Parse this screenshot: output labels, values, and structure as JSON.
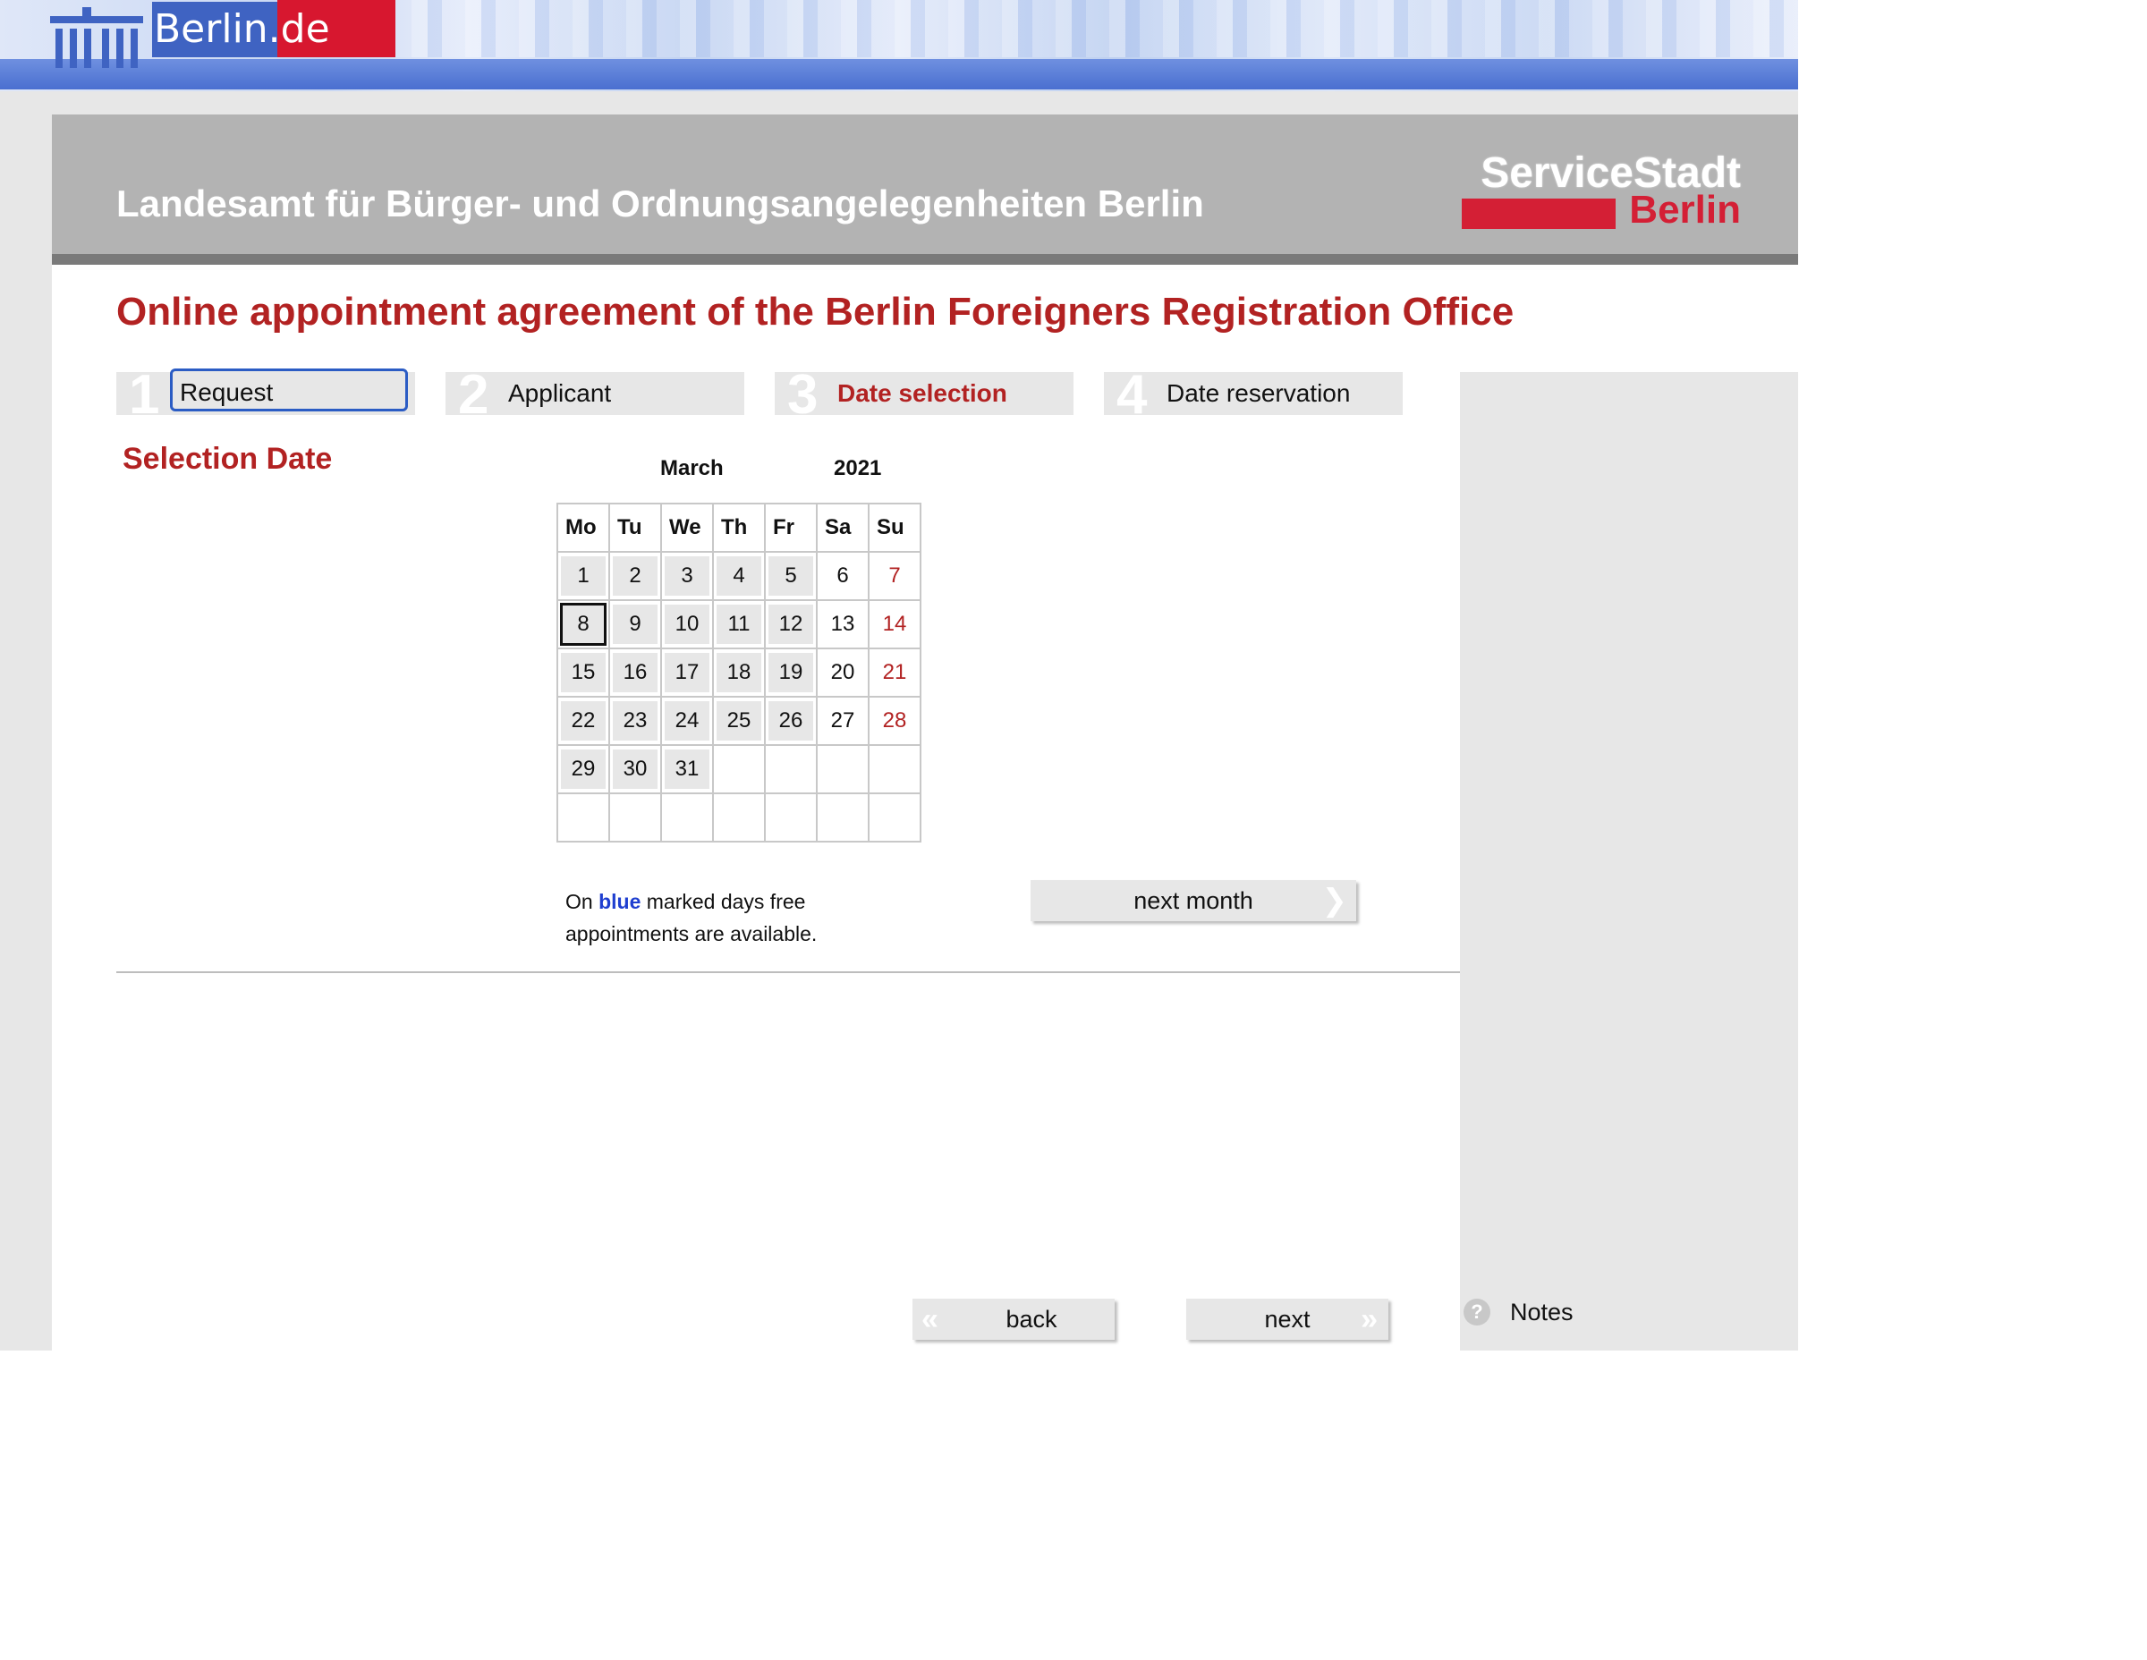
{
  "site": {
    "brand": "Berlin.de"
  },
  "header": {
    "office_title": "Landesamt für Bürger- und Ordnungsangelegenheiten Berlin",
    "logo_line1": "ServiceStadt",
    "logo_line2": "Berlin"
  },
  "page": {
    "heading": "Online appointment agreement of the Berlin Foreigners Registration Office"
  },
  "steps": [
    {
      "number": "1",
      "label": "Request",
      "state": "focused"
    },
    {
      "number": "2",
      "label": "Applicant",
      "state": "normal"
    },
    {
      "number": "3",
      "label": "Date selection",
      "state": "active"
    },
    {
      "number": "4",
      "label": "Date reservation",
      "state": "normal"
    }
  ],
  "selection": {
    "label": "Selection Date"
  },
  "calendar": {
    "month": "March",
    "year": "2021",
    "weekdays": [
      "Mo",
      "Tu",
      "We",
      "Th",
      "Fr",
      "Sa",
      "Su"
    ],
    "weeks": [
      [
        "1",
        "2",
        "3",
        "4",
        "5",
        "6",
        "7"
      ],
      [
        "8",
        "9",
        "10",
        "11",
        "12",
        "13",
        "14"
      ],
      [
        "15",
        "16",
        "17",
        "18",
        "19",
        "20",
        "21"
      ],
      [
        "22",
        "23",
        "24",
        "25",
        "26",
        "27",
        "28"
      ],
      [
        "29",
        "30",
        "31",
        "",
        "",
        "",
        ""
      ],
      [
        "",
        "",
        "",
        "",
        "",
        "",
        ""
      ]
    ],
    "today": "8"
  },
  "legend": {
    "prefix": "On",
    "highlight": "blue",
    "suffix": "marked days free appointments are available."
  },
  "buttons": {
    "next_month": "next month",
    "back": "back",
    "next": "next"
  },
  "sidebar": {
    "notes_label": "Notes",
    "notes_icon": "question-circle-icon"
  },
  "colors": {
    "accent_red": "#b22222",
    "link_blue": "#1f3fd0",
    "brand_blue": "#3f63c2"
  }
}
